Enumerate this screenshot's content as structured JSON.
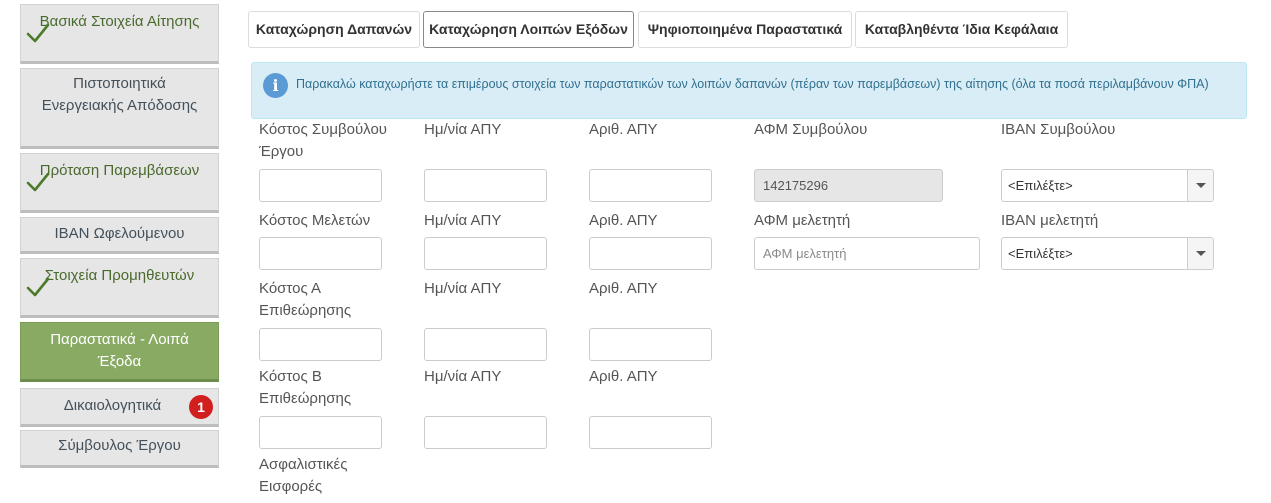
{
  "sidebar": {
    "items": [
      {
        "label": "Βασικά Στοιχεία Αίτησης",
        "done": true
      },
      {
        "label": "Πιστοποιητικά Ενεργειακής Απόδοσης",
        "done": false
      },
      {
        "label": "Πρόταση Παρεμβάσεων",
        "done": true
      },
      {
        "label": "IBAN Ωφελούμενου",
        "done": false
      },
      {
        "label": "Στοιχεία Προμηθευτών",
        "done": true
      },
      {
        "label": "Παραστατικά - Λοιπά Έξοδα",
        "active": true
      },
      {
        "label": "Δικαιολογητικά",
        "badge": "1"
      },
      {
        "label": "Σύμβουλος Έργου"
      }
    ]
  },
  "tabs": [
    {
      "label": "Καταχώρηση Δαπανών"
    },
    {
      "label": "Καταχώρηση Λοιπών Εξόδων",
      "active": true
    },
    {
      "label": "Ψηφιοποιημένα Παραστατικά"
    },
    {
      "label": "Καταβληθέντα Ίδια Κεφάλαια"
    }
  ],
  "alert": {
    "icon": "info-icon",
    "text": "Παρακαλώ καταχωρήστε τα επιμέρους στοιχεία των παραστατικών των λοιπών δαπανών (πέραν των παρεμβάσεων) της αίτησης (όλα τα ποσά περιλαμβάνουν ΦΠΑ)"
  },
  "form": {
    "rows": [
      {
        "cost_label": "Κόστος Συμβούλου Έργου",
        "date_label": "Ημ/νία ΑΠΥ",
        "num_label": "Αριθ. ΑΠΥ",
        "afm_label": "ΑΦΜ Συμβούλου",
        "afm_value": "142175296",
        "iban_label": "IBAN Συμβούλου",
        "iban_value": "<Επιλέξτε>"
      },
      {
        "cost_label": "Κόστος Μελετών",
        "date_label": "Ημ/νία ΑΠΥ",
        "num_label": "Αριθ. ΑΠΥ",
        "afm_label": "ΑΦΜ μελετητή",
        "afm_placeholder": "ΑΦΜ μελετητή",
        "iban_label": "IBAN μελετητή",
        "iban_value": "<Επιλέξτε>"
      },
      {
        "cost_label": "Κόστος Α Επιθεώρησης",
        "date_label": "Ημ/νία ΑΠΥ",
        "num_label": "Αριθ. ΑΠΥ"
      },
      {
        "cost_label": "Κόστος Β Επιθεώρησης",
        "date_label": "Ημ/νία ΑΠΥ",
        "num_label": "Αριθ. ΑΠΥ"
      },
      {
        "cost_label": "Ασφαλιστικές Εισφορές"
      }
    ]
  },
  "colors": {
    "accent_green": "#88aa63",
    "check_green": "#4a7a2a",
    "badge_red": "#d11f1f",
    "alert_bg": "#d9edf7",
    "alert_text": "#31708f"
  }
}
